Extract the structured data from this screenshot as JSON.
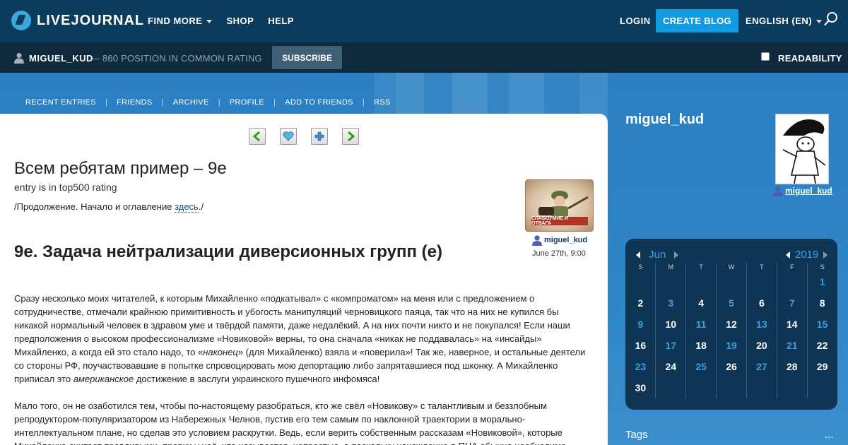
{
  "header": {
    "logo_text": "LIVEJOURNAL",
    "nav": [
      "FIND MORE",
      "SHOP",
      "HELP"
    ],
    "login": "LOGIN",
    "create_blog": "CREATE BLOG",
    "language": "ENGLISH (EN)"
  },
  "userbar": {
    "username": "MIGUEL_KUD",
    "rating": "— 860 POSITION IN COMMON RATING",
    "subscribe": "SUBSCRIBE",
    "readability": "READABILITY"
  },
  "sublinks": [
    "RECENT ENTRIES",
    "FRIENDS",
    "ARCHIVE",
    "PROFILE",
    "ADD TO FRIENDS",
    "RSS"
  ],
  "post": {
    "title": "Всем ребятам пример – 9е",
    "top500": "entry is in top500 rating",
    "continuation_prefix": "/Продолжение. Начало и оглавление ",
    "continuation_link": "здесь",
    "continuation_suffix": "./",
    "badge_text": "СЛАБОУМИЕ И ОТВАГА",
    "author": "miguel_kud",
    "date": "June 27th, 9:00",
    "heading": "9е. Задача нейтрализации диверсионных групп (е)",
    "p1_a": "Сразу несколько моих читателей, к которым Михайленко «подкатывал» с «компроматом» на меня или с предложением о сотрудничестве, отмечали крайнюю примитивность и убогость манипуляций черновицкого паяца, так что на них не купился бы никакой нормальный человек в здравом уме и твёрдой памяти, даже недалёкий. А на них почти никто и не покупался! Если наши предположения о высоком профессионализме «Новиковой» верны, то она сначала «никак не поддавалась» на «инсайды» Михайленко, а когда ей это стало надо, то «",
    "p1_em1": "наконец",
    "p1_b": "» (для Михайленко) взяла и «поверила»! Так же, наверное, и остальные деятели со стороны РФ, поучаствовавшие в попытке спровоцировать мою депортацию либо запрятавшиеся под шконку. А Михайленко приписал это ",
    "p1_em2": "американское",
    "p1_c": " достижение в заслуги украинского пушечного инфомяса!",
    "p2": "Мало того, он не озаботился тем, чтобы по-настоящему разобраться, кто же свёл «Новикову» с талантливым и беззлобным репродуктором-популяризатором из Набережных Челнов, пустив его тем самым по наклонной траектории в морально-интеллектуальном плане, но сделав это условием раскрутки. Ведь, если верить собственным рассказам «Новиковой», которые Михайленко считает правдивыми, правки у неё, что называется, непростые, а поскольку нахождение в ПНА обычно необходимо"
  },
  "sidebar": {
    "name": "miguel_kud",
    "user_link": "miguel_kud",
    "tags_label": "Tags",
    "tags_more": "..."
  },
  "calendar": {
    "month": "Jun",
    "year": "2019",
    "dow": [
      "S",
      "M",
      "T",
      "W",
      "T",
      "F",
      "S"
    ],
    "weeks": [
      [
        "",
        "",
        "",
        "",
        "",
        "",
        "1"
      ],
      [
        "2",
        "3",
        "4",
        "5",
        "6",
        "7",
        "8"
      ],
      [
        "9",
        "10",
        "11",
        "12",
        "13",
        "14",
        "15"
      ],
      [
        "16",
        "17",
        "18",
        "19",
        "20",
        "21",
        "22"
      ],
      [
        "23",
        "24",
        "25",
        "26",
        "27",
        "28",
        "29"
      ],
      [
        "30",
        "",
        "",
        "",
        "",
        "",
        ""
      ]
    ],
    "linked_days": [
      "1",
      "3",
      "5",
      "7",
      "9",
      "11",
      "13",
      "15",
      "17",
      "19",
      "21",
      "23",
      "25",
      "27"
    ]
  },
  "colors": {
    "topbar": "#0b3c5d",
    "userbar": "#0f2a3d",
    "accent": "#129be1",
    "banner": "#2f86c7",
    "calendar_bg": "#0e3553",
    "calendar_link": "#3d9fe0"
  }
}
